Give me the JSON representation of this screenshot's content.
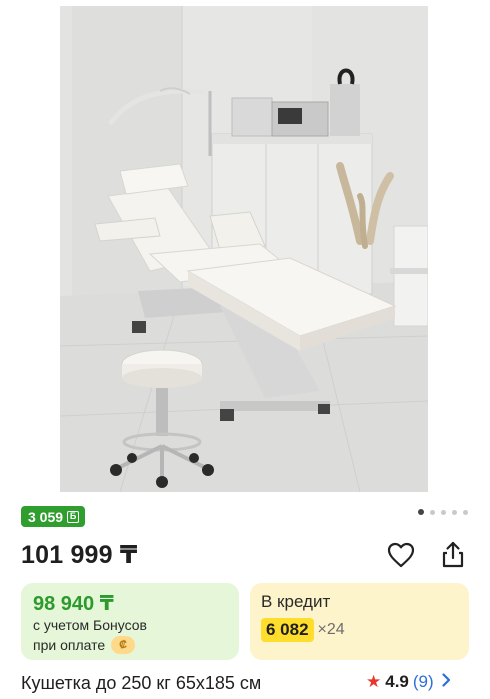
{
  "product": {
    "bonus_badge": {
      "value": "3 059",
      "icon": "bonus-b-icon",
      "icon_glyph": "Б"
    },
    "price": "101 999 ₸",
    "pager": {
      "count": 5,
      "active_index": 0
    },
    "bonus_offer": {
      "price": "98 940 ₸",
      "line1": "с учетом Бонусов",
      "line2": "при оплате",
      "icon": "coin-icon",
      "icon_glyph": "₡"
    },
    "credit_offer": {
      "label": "В кредит",
      "amount": "6 082",
      "months": "×24"
    },
    "title": "Кушетка до 250 кг 65х185 см",
    "rating": {
      "score": "4.9",
      "count": "(9)"
    }
  },
  "colors": {
    "bonus_green": "#2f9e2f",
    "credit_yellow": "#ffdd2d",
    "star_red": "#e8362a",
    "link_blue": "#2d6fd8"
  }
}
